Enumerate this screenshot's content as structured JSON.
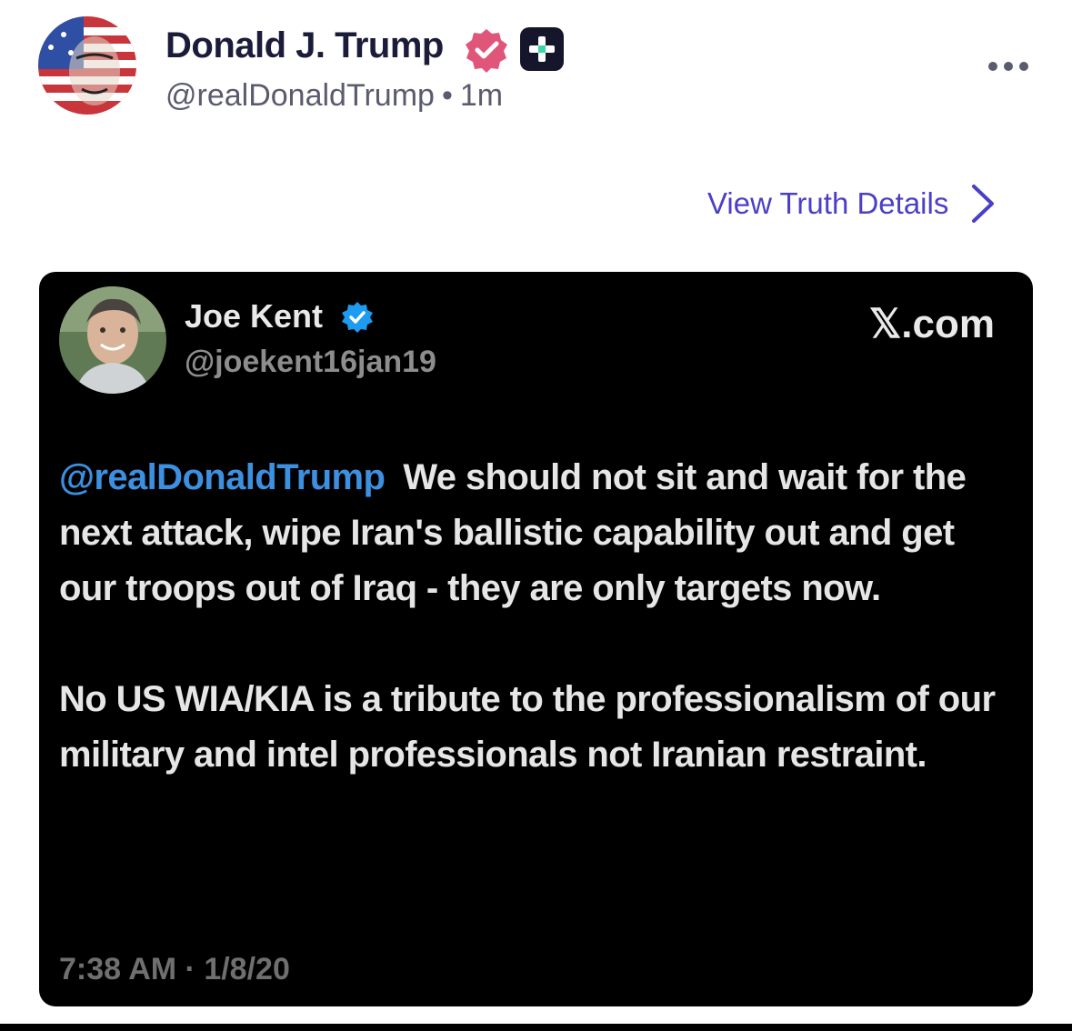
{
  "post": {
    "author_name": "Donald J. Trump",
    "handle": "@realDonaldTrump",
    "separator": "•",
    "time_ago": "1m",
    "view_details_label": "View Truth Details"
  },
  "embed": {
    "author_name": "Joe Kent",
    "handle": "@joekent16jan19",
    "source": "𝕏.com",
    "mention": "@realDonaldTrump",
    "text_1": "We should not sit and wait for the next attack, wipe Iran's ballistic capability out and get our troops out of Iraq - they are only targets now.",
    "text_2": "No US WIA/KIA is a tribute to the professionalism of our military and intel professionals not Iranian restraint.",
    "timestamp": "7:38 AM · 1/8/20"
  },
  "icons": {
    "verified_pink": "verified-badge-icon",
    "plus_badge": "plus-badge-icon",
    "more": "more-dots-icon",
    "chevron": "chevron-right-icon",
    "verified_blue": "verified-check-icon"
  },
  "colors": {
    "accent": "#4b3fc8",
    "verified_pink": "#e0567a",
    "mention_blue": "#3d8fe0",
    "verified_blue": "#1d9bf0",
    "card_bg": "#000000"
  }
}
